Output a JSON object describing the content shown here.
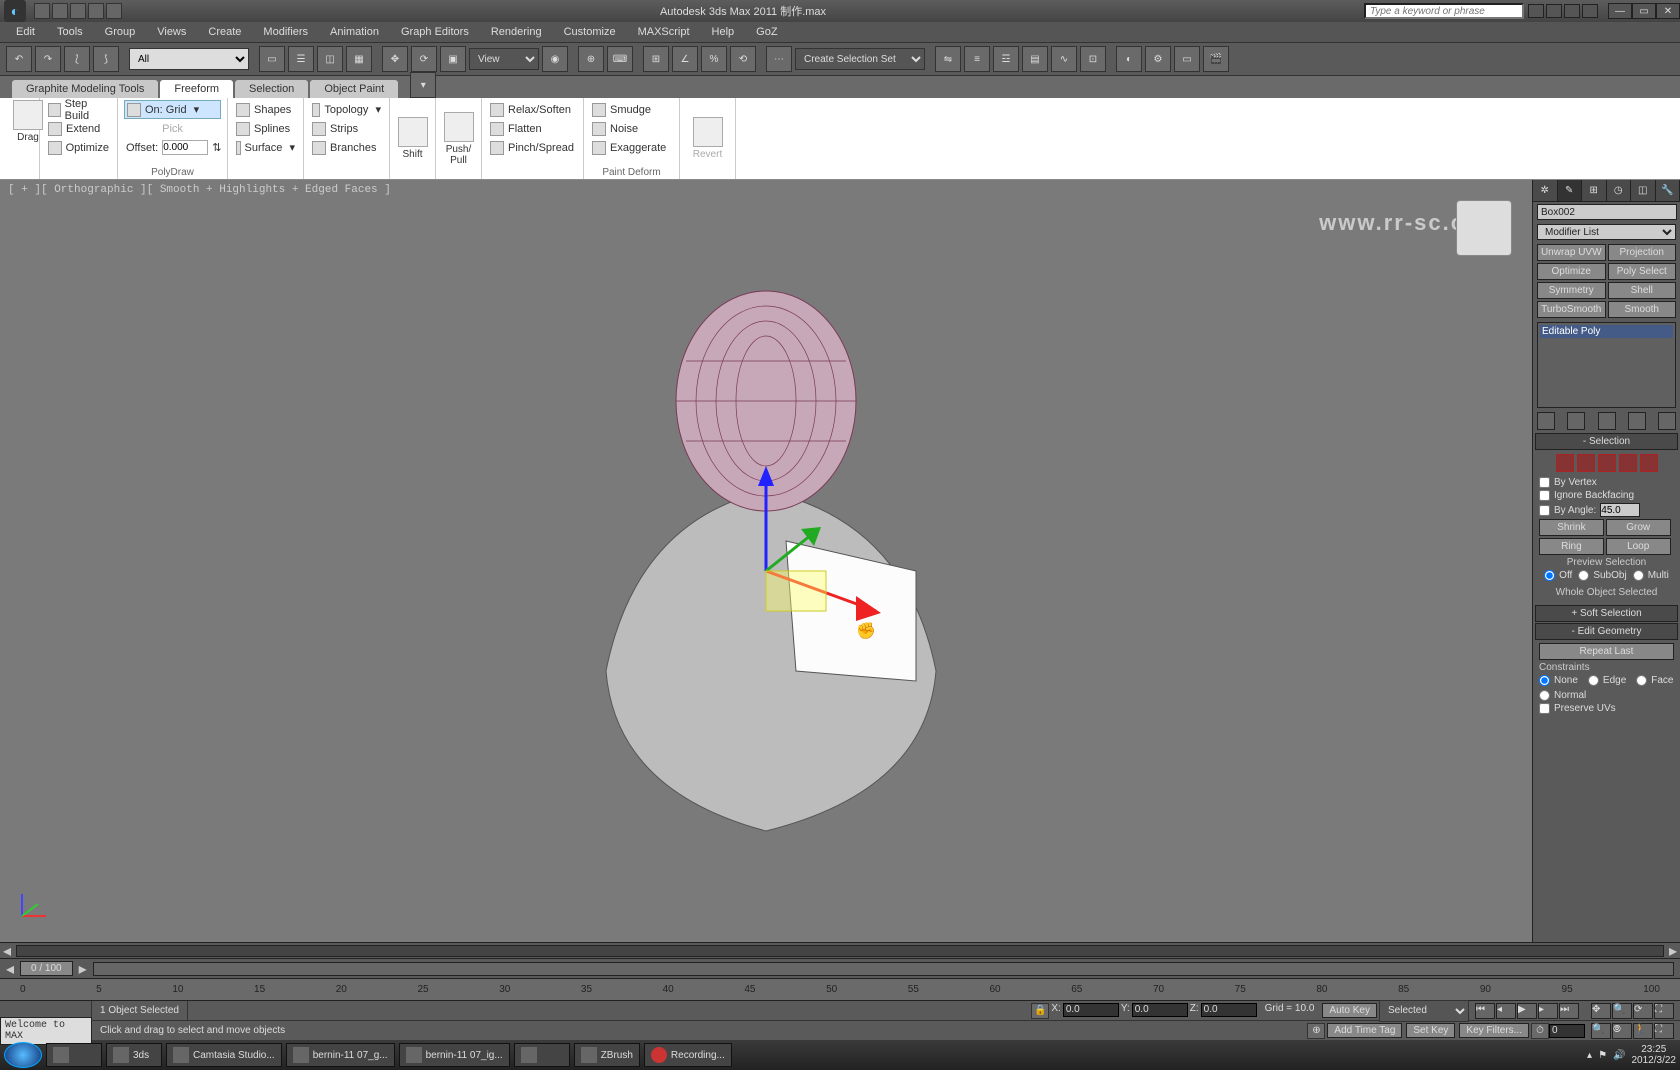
{
  "titlebar": {
    "title": "Autodesk 3ds Max 2011    制作.max",
    "search_placeholder": "Type a keyword or phrase"
  },
  "menu": [
    "Edit",
    "Tools",
    "Group",
    "Views",
    "Create",
    "Modifiers",
    "Animation",
    "Graph Editors",
    "Rendering",
    "Customize",
    "MAXScript",
    "Help",
    "GoZ"
  ],
  "toolbar": {
    "selset_dropdown": "All",
    "refcoord": "View",
    "named_sel": "Create Selection Set"
  },
  "ribbon": {
    "tabs": [
      "Graphite Modeling Tools",
      "Freeform",
      "Selection",
      "Object Paint"
    ],
    "active_tab": 1,
    "groups": {
      "polydraw": {
        "name": "PolyDraw",
        "drag": "Drag",
        "items": [
          "Step Build",
          "Extend",
          "Optimize"
        ],
        "ongrid": "On: Grid",
        "pick": "Pick",
        "offset_label": "Offset:",
        "offset_value": "0.000"
      },
      "cols2": [
        "Shapes",
        "Splines",
        "Surface"
      ],
      "cols3": [
        "Topology",
        "Strips",
        "Branches"
      ],
      "shift": "Shift",
      "pushpull": "Push/\nPull",
      "deform1": [
        "Relax/Soften",
        "Flatten",
        "Pinch/Spread"
      ],
      "deform2": [
        "Smudge",
        "Noise",
        "Exaggerate"
      ],
      "paintdeform_label": "Paint Deform",
      "revert": "Revert"
    }
  },
  "viewport": {
    "label": "[ + ][ Orthographic ][ Smooth + Highlights + Edged Faces ]",
    "watermark": "www.rr-sc.com"
  },
  "sidepanel": {
    "object_name": "Box002",
    "modifier_list": "Modifier List",
    "mod_buttons": [
      "Unwrap UVW",
      "Projection",
      "Optimize",
      "Poly Select",
      "Symmetry",
      "Shell",
      "TurboSmooth",
      "Smooth"
    ],
    "stack_item": "Editable Poly",
    "selection": {
      "title": "Selection",
      "by_vertex": "By Vertex",
      "ignore_backfacing": "Ignore Backfacing",
      "by_angle": "By Angle:",
      "angle_value": "45.0",
      "shrink": "Shrink",
      "grow": "Grow",
      "ring": "Ring",
      "loop": "Loop",
      "preview_label": "Preview Selection",
      "preview_opts": [
        "Off",
        "SubObj",
        "Multi"
      ],
      "whole": "Whole Object Selected"
    },
    "soft_selection": "Soft Selection",
    "edit_geometry": "Edit Geometry",
    "repeat_last": "Repeat Last",
    "constraints": {
      "label": "Constraints",
      "opts": [
        "None",
        "Edge",
        "Face",
        "Normal"
      ]
    },
    "preserve_uvs": "Preserve UVs"
  },
  "timeslider": {
    "label": "0 / 100"
  },
  "trackbar_ticks": [
    "0",
    "5",
    "10",
    "15",
    "20",
    "25",
    "30",
    "35",
    "40",
    "45",
    "50",
    "55",
    "60",
    "65",
    "70",
    "75",
    "80",
    "85",
    "90",
    "95",
    "100"
  ],
  "status": {
    "objects": "1 Object Selected",
    "x": "0.0",
    "y": "0.0",
    "z": "0.0",
    "grid": "Grid = 10.0",
    "autokey": "Auto Key",
    "setkey": "Set Key",
    "selected": "Selected",
    "keyfilters": "Key Filters...",
    "addtimetag": "Add Time Tag",
    "welcome": "Welcome to MAX",
    "prompt": "Click and drag to select and move objects",
    "spinner": "0"
  },
  "taskbar": {
    "items": [
      "",
      "3ds",
      "Camtasia Studio...",
      "bernin-11 07_g...",
      "bernin-11 07_ig...",
      "",
      "ZBrush",
      "Recording..."
    ],
    "time": "23:25",
    "date": "2012/3/22"
  }
}
